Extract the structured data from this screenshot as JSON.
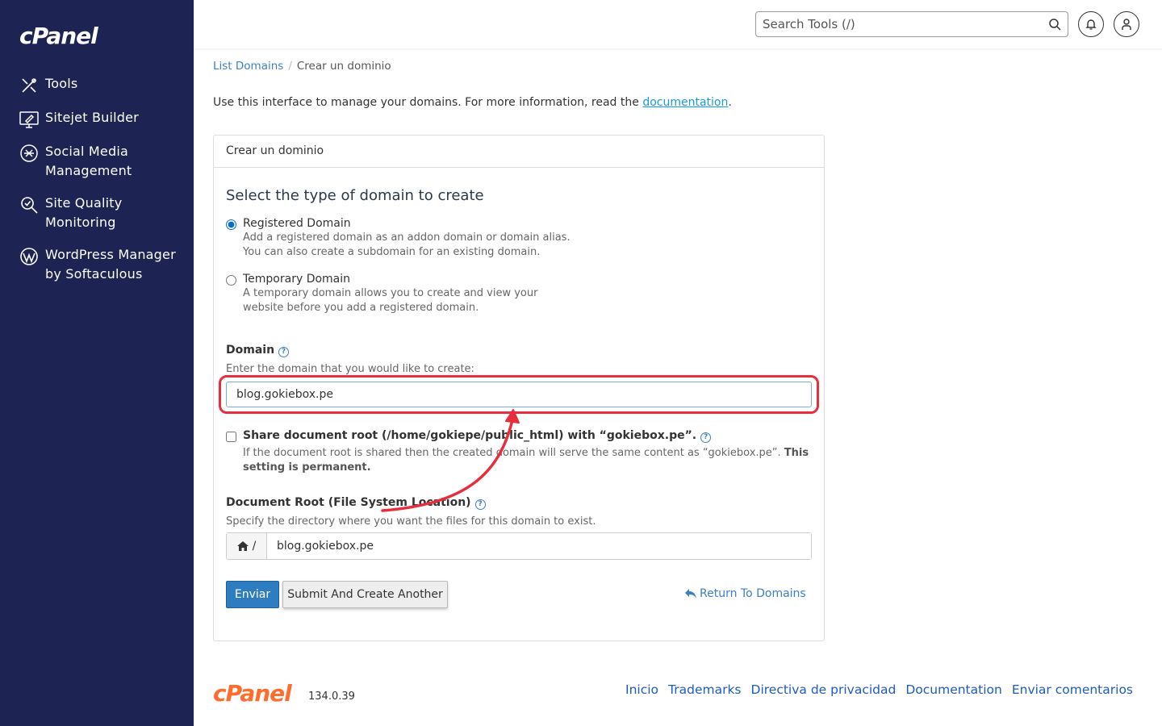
{
  "brand": {
    "logo": "cPanel"
  },
  "sidebar": {
    "items": [
      {
        "label": "Tools"
      },
      {
        "label": "Sitejet Builder"
      },
      {
        "label": "Social Media Management"
      },
      {
        "label": "Site Quality Monitoring"
      },
      {
        "label": "WordPress Manager by Softaculous"
      }
    ]
  },
  "header": {
    "search_placeholder": "Search Tools (/)"
  },
  "breadcrumb": {
    "parent": "List Domains",
    "separator": "/",
    "current": "Crear un dominio"
  },
  "intro": {
    "text": "Use this interface to manage your domains. For more information, read the ",
    "link": "documentation",
    "end": "."
  },
  "panel": {
    "heading": "Crear un dominio",
    "section_title": "Select the type of domain to create",
    "radio_registered": {
      "title": "Registered Domain",
      "desc_line1": "Add a registered domain as an addon domain or domain alias.",
      "desc_line2": "You can also create a subdomain for an existing domain.",
      "checked": true
    },
    "radio_temporary": {
      "title": "Temporary Domain",
      "desc_line1": "A temporary domain allows you to create and view your",
      "desc_line2": "website before you add a registered domain.",
      "checked": false
    },
    "domain": {
      "label": "Domain",
      "hint": "Enter the domain that you would like to create:",
      "value": "blog.gokiebox.pe"
    },
    "share": {
      "label": "Share document root (/home/gokiepe/public_html) with “gokiebox.pe”.",
      "desc": "If the document root is shared then the created domain will serve the same content as “gokiebox.pe”. ",
      "desc_bold": "This setting is permanent."
    },
    "docroot": {
      "label": "Document Root (File System Location)",
      "hint": "Specify the directory where you want the files for this domain to exist.",
      "prefix": "/",
      "value": "blog.gokiebox.pe"
    },
    "buttons": {
      "submit": "Enviar",
      "submit_another": "Submit And Create Another",
      "return": "Return To Domains"
    }
  },
  "footer": {
    "logo": "cPanel",
    "version": "134.0.39",
    "links": [
      "Inicio",
      "Trademarks",
      "Directiva de privacidad",
      "Documentation",
      "Enviar comentarios"
    ]
  },
  "colors": {
    "sidebar_bg": "#1d2453",
    "accent": "#2f7dc1",
    "highlight": "#e62e3d",
    "footer_logo": "#ff6c2c"
  }
}
